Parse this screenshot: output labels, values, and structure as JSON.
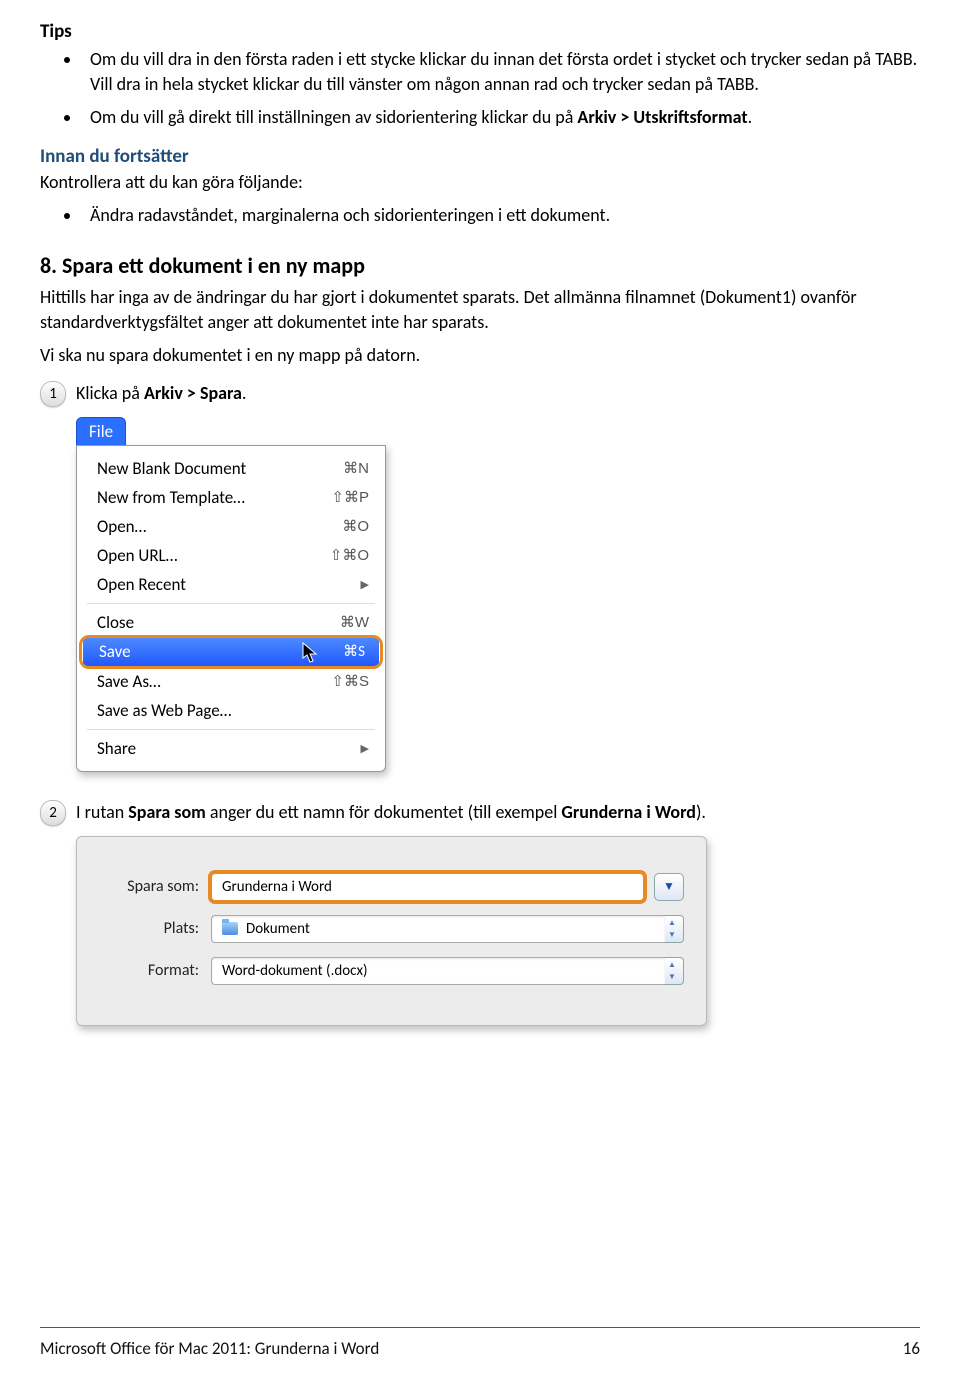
{
  "tips_heading": "Tips",
  "tips": [
    {
      "pre": "Om du vill dra in den första raden i ett stycke klickar du innan det första ordet i stycket och trycker sedan på TABB. Vill dra in hela stycket klickar du till vänster om någon annan rad och trycker sedan på TABB.",
      "b": "",
      "post": ""
    },
    {
      "pre": "Om du vill gå direkt till inställningen av sidorientering klickar du på ",
      "b": "Arkiv > Utskriftsformat",
      "post": "."
    }
  ],
  "innan_heading": "Innan du fortsätter",
  "innan_text": "Kontrollera att du kan göra följande:",
  "innan_bullet": "Ändra radavståndet, marginalerna och sidorienteringen i ett dokument.",
  "section8_heading": "8. Spara ett dokument i en ny mapp",
  "section8_p1": "Hittills har inga av de ändringar du har gjort i dokumentet sparats. Det allmänna filnamnet (Dokument1) ovanför standardverktygsfältet anger att dokumentet inte har sparats.",
  "section8_p2": "Vi ska nu spara dokumentet i en ny mapp på datorn.",
  "step1_num": "1",
  "step1_pre": "Klicka på ",
  "step1_b": "Arkiv > Spara",
  "step1_post": ".",
  "file_tab": "File",
  "menu": {
    "nbd": {
      "label": "New Blank Document",
      "kb": "⌘N"
    },
    "nft": {
      "label": "New from Template…",
      "kb": "⇧⌘P"
    },
    "open": {
      "label": "Open…",
      "kb": "⌘O"
    },
    "ourl": {
      "label": "Open URL…",
      "kb": "⇧⌘O"
    },
    "orec": {
      "label": "Open Recent"
    },
    "close": {
      "label": "Close",
      "kb": "⌘W"
    },
    "save": {
      "label": "Save",
      "kb": "⌘S"
    },
    "saveas": {
      "label": "Save As…",
      "kb": "⇧⌘S"
    },
    "saveweb": {
      "label": "Save as Web Page…"
    },
    "share": {
      "label": "Share"
    }
  },
  "step2_num": "2",
  "step2_pre": "I rutan ",
  "step2_b1": "Spara som",
  "step2_mid": " anger du ett namn för dokumentet (till exempel ",
  "step2_b2": "Grunderna i Word",
  "step2_post": ").",
  "dlg": {
    "saveas_label": "Spara som:",
    "saveas_value": "Grunderna i Word",
    "plats_label": "Plats:",
    "plats_value": "Dokument",
    "format_label": "Format:",
    "format_value": "Word-dokument (.docx)"
  },
  "footer_left": "Microsoft Office för Mac 2011: Grunderna i Word",
  "footer_right": "16"
}
